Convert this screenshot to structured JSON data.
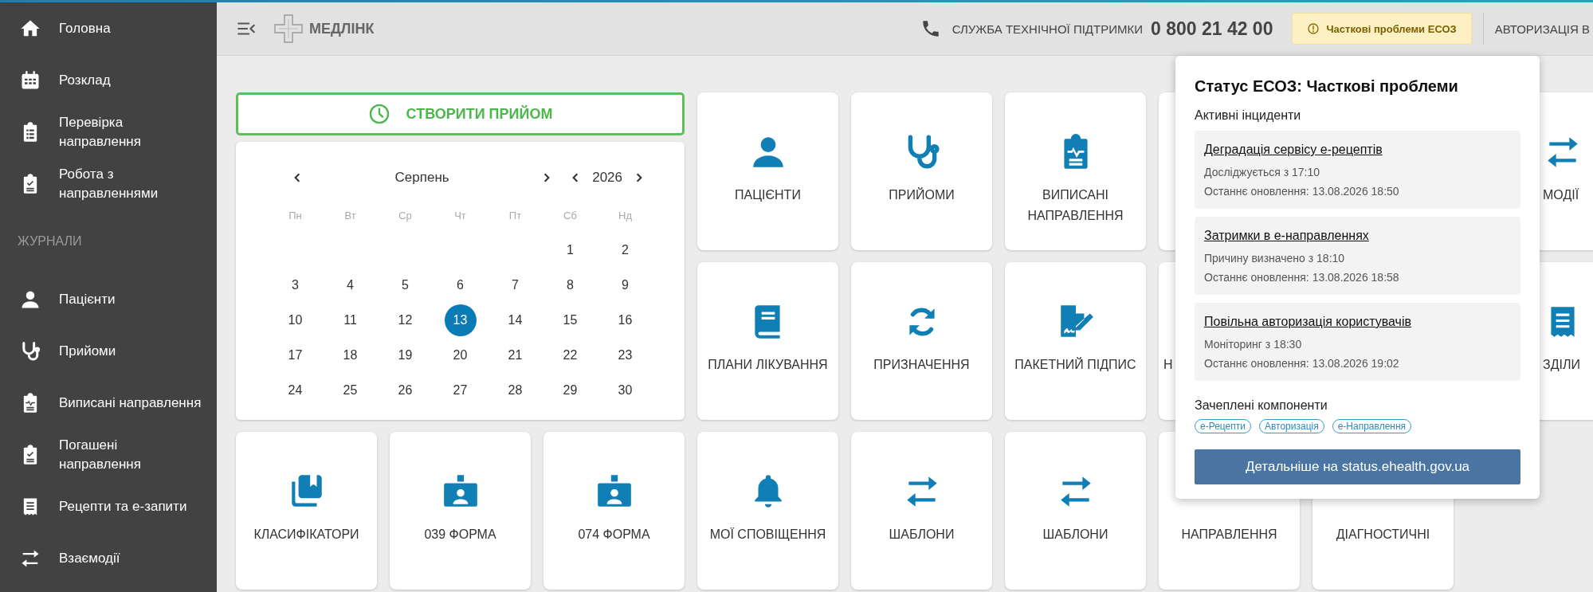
{
  "sidebar": {
    "items": [
      {
        "kind": "home",
        "label": "Головна"
      },
      {
        "kind": "calendar",
        "label": "Розклад"
      },
      {
        "kind": "checklist",
        "label": "Перевірка\nнаправлення"
      },
      {
        "kind": "clipboard-check",
        "label": "Робота з\nнаправленнями"
      },
      {
        "kind": "section",
        "label": "ЖУРНАЛИ"
      },
      {
        "kind": "person",
        "label": "Пацієнти"
      },
      {
        "kind": "stethoscope",
        "label": "Прийоми"
      },
      {
        "kind": "clipboard-pulse",
        "label": "Виписані направлення"
      },
      {
        "kind": "clipboard-check",
        "label": "Погашені\nнаправлення"
      },
      {
        "kind": "receipt",
        "label": "Рецепти та е-запити"
      },
      {
        "kind": "transfer",
        "label": "Взаємодії"
      }
    ]
  },
  "header": {
    "brand": "МЕДЛІНК",
    "support_label": "СЛУЖБА ТЕХНІЧНОЇ ПІДТРИМКИ",
    "support_phone": "0 800 21 42 00",
    "status_badge": "Часткові проблеми ЕСОЗ",
    "auth_link": "АВТОРИЗАЦІЯ В"
  },
  "create_button": "СТВОРИТИ ПРИЙОМ",
  "calendar": {
    "month": "Серпень",
    "year": "2026",
    "weekdays": [
      "Пн",
      "Вт",
      "Ср",
      "Чт",
      "Пт",
      "Сб",
      "Нд"
    ],
    "weeks": [
      [
        {
          "day": "1",
          "selected": false
        },
        {
          "day": "2",
          "selected": false
        }
      ],
      [
        {
          "day": "3",
          "selected": false
        },
        {
          "day": "4",
          "selected": false
        },
        {
          "day": "5",
          "selected": false
        },
        {
          "day": "6",
          "selected": false
        },
        {
          "day": "7",
          "selected": false
        },
        {
          "day": "8",
          "selected": false
        },
        {
          "day": "9",
          "selected": false
        }
      ],
      [
        {
          "day": "10",
          "selected": false
        },
        {
          "day": "11",
          "selected": false
        },
        {
          "day": "12",
          "selected": false
        },
        {
          "day": "13",
          "selected": true
        },
        {
          "day": "14",
          "selected": false
        },
        {
          "day": "15",
          "selected": false
        },
        {
          "day": "16",
          "selected": false
        }
      ],
      [
        {
          "day": "17",
          "selected": false
        },
        {
          "day": "18",
          "selected": false
        },
        {
          "day": "19",
          "selected": false
        },
        {
          "day": "20",
          "selected": false
        },
        {
          "day": "21",
          "selected": false
        },
        {
          "day": "22",
          "selected": false
        },
        {
          "day": "23",
          "selected": false
        }
      ],
      [
        {
          "day": "24",
          "selected": false
        },
        {
          "day": "25",
          "selected": false
        },
        {
          "day": "26",
          "selected": false
        },
        {
          "day": "27",
          "selected": false
        },
        {
          "day": "28",
          "selected": false
        },
        {
          "day": "29",
          "selected": false
        },
        {
          "day": "30",
          "selected": false
        }
      ]
    ]
  },
  "tiles_top": [
    {
      "kind": "person",
      "label": "ПАЦІЄНТИ"
    },
    {
      "kind": "stethoscope",
      "label": "ПРИЙОМИ"
    },
    {
      "kind": "clipboard-pulse",
      "label": "ВИПИСАНІ НАПРАВЛЕННЯ"
    },
    {
      "kind": "covered"
    },
    {
      "kind": "covered"
    },
    {
      "kind": "transfer",
      "label": "МОДІЇ"
    },
    {
      "kind": "book",
      "label": "ПЛАНИ ЛІКУВАННЯ"
    },
    {
      "kind": "sync",
      "label": "ПРИЗНАЧЕННЯ"
    },
    {
      "kind": "signature",
      "label": "ПАКЕТНИЙ ПІДПИС"
    },
    {
      "kind": "label-only",
      "label": "Н"
    },
    {
      "kind": "covered"
    },
    {
      "kind": "receipt",
      "label": "ЗДІЛИ"
    }
  ],
  "tiles_bottom": [
    {
      "kind": "classifiers",
      "label": "КЛАСИФІКАТОРИ"
    },
    {
      "kind": "id-card",
      "label": "039 ФОРМА"
    },
    {
      "kind": "id-card",
      "label": "074 ФОРМА"
    },
    {
      "kind": "bell",
      "label": "МОЇ СПОВІЩЕННЯ"
    },
    {
      "kind": "transfer",
      "label": "ШАБЛОНИ"
    },
    {
      "kind": "transfer",
      "label": "ШАБЛОНИ"
    },
    {
      "kind": "label-only",
      "label": "НАПРАВЛЕННЯ"
    },
    {
      "kind": "label-only",
      "label": "ДІАГНОСТИЧНІ"
    }
  ],
  "status_popup": {
    "title": "Статус ЕСОЗ: Часткові проблеми",
    "incidents_heading": "Активні інциденти",
    "incidents": [
      {
        "title": "Деградація сервісу е-рецептів",
        "status": "Досліджується з 17:10",
        "updated": "Останнє оновлення: 13.08.2026 18:50"
      },
      {
        "title": "Затримки в е-направленнях",
        "status": "Причину визначено з 18:10",
        "updated": "Останнє оновлення: 13.08.2026 18:58"
      },
      {
        "title": "Повільна авторизація користувачів",
        "status": "Моніторинг з 18:30",
        "updated": "Останнє оновлення: 13.08.2026 19:02"
      }
    ],
    "components_heading": "Зачеплені компоненти",
    "components": [
      "е-Рецепти",
      "Авторизація",
      "е-Направлення"
    ],
    "details_button": "Детальніше на status.ehealth.gov.ua"
  }
}
